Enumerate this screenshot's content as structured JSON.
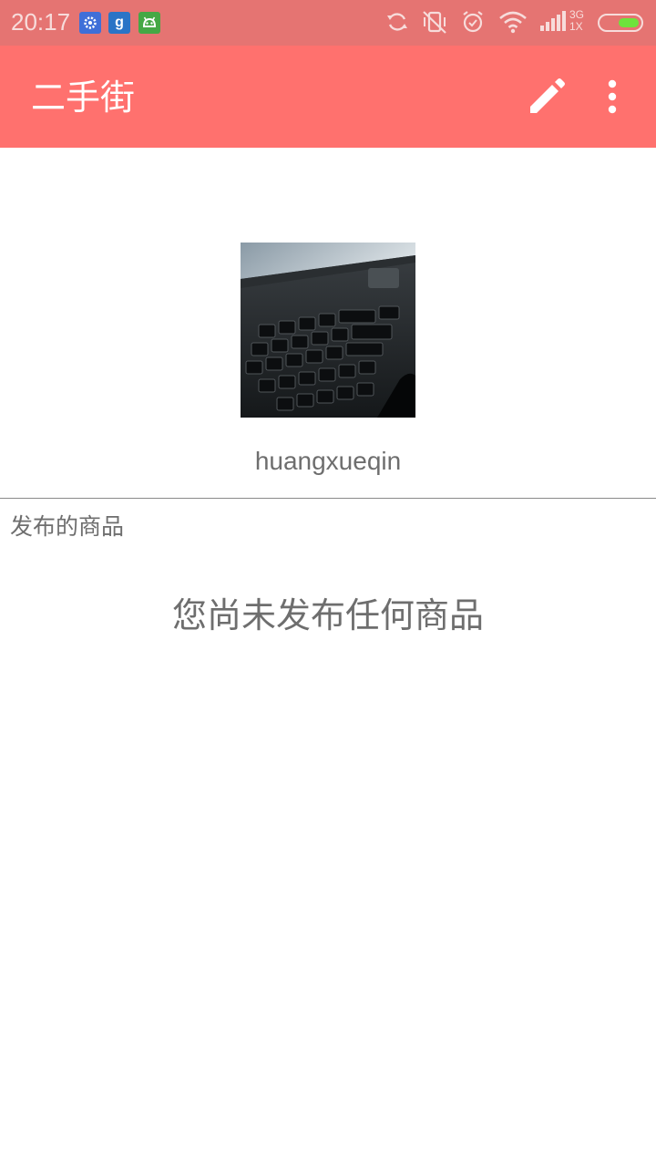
{
  "status_bar": {
    "time": "20:17",
    "notification_icons": [
      "gear-icon",
      "google-icon",
      "android-face-icon"
    ],
    "network_top": "3G",
    "network_bottom": "1X",
    "battery_level": 0.55
  },
  "app_bar": {
    "title": "二手街",
    "actions": [
      "edit-icon",
      "more-vertical-icon"
    ]
  },
  "profile": {
    "username": "huangxueqin"
  },
  "products": {
    "section_label": "发布的商品",
    "empty_message": "您尚未发布任何商品"
  },
  "colors": {
    "status_bar": "#e57472",
    "app_bar": "#ff716e",
    "text_gray": "#6e6e6e",
    "battery_fill": "#6ee33b"
  }
}
